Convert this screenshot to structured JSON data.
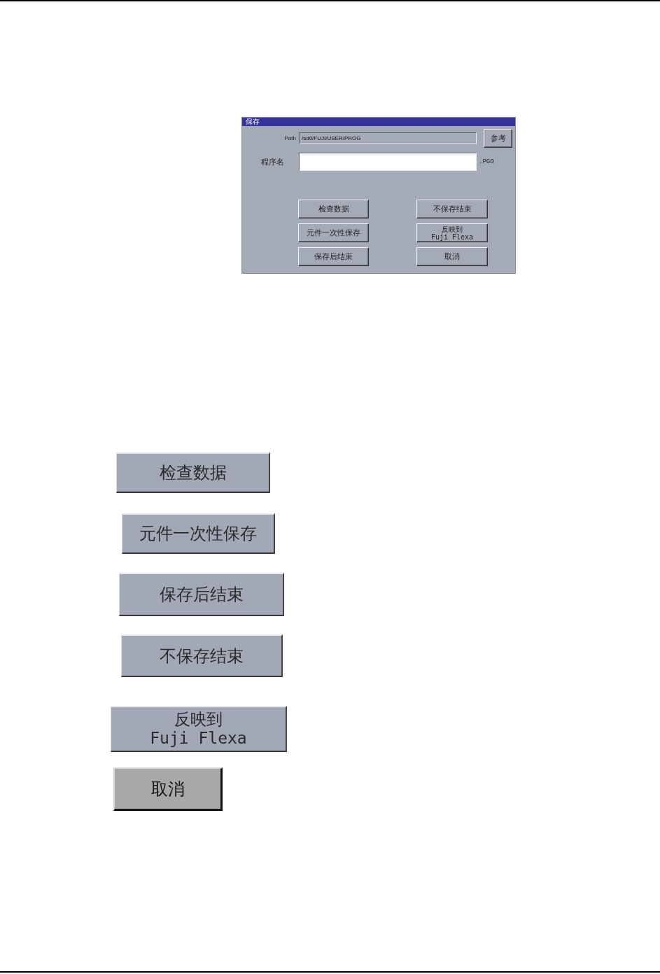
{
  "dialog": {
    "title": "保存",
    "path": {
      "label": "Path",
      "value": "/sd0/FUJI/USER/PROG"
    },
    "browse_button": "参考",
    "program_name": {
      "label": "程序名",
      "extension": ".PGO"
    },
    "buttons": [
      {
        "label": "检查数据"
      },
      {
        "label": "不保存结束"
      },
      {
        "label": "元件一次性保存"
      },
      {
        "label": "反映到\nFuji Flexa"
      },
      {
        "label": "保存后结束"
      },
      {
        "label": "取消"
      }
    ]
  },
  "button_samples": [
    {
      "label": "检查数据",
      "kind": "standard"
    },
    {
      "label": "元件一次性保存",
      "kind": "standard"
    },
    {
      "label": "保存后结束",
      "kind": "standard"
    },
    {
      "label": "不保存结束",
      "kind": "standard"
    },
    {
      "label": "反映到\nFuji Flexa",
      "kind": "standard"
    },
    {
      "label": "取消",
      "kind": "neutral"
    }
  ]
}
